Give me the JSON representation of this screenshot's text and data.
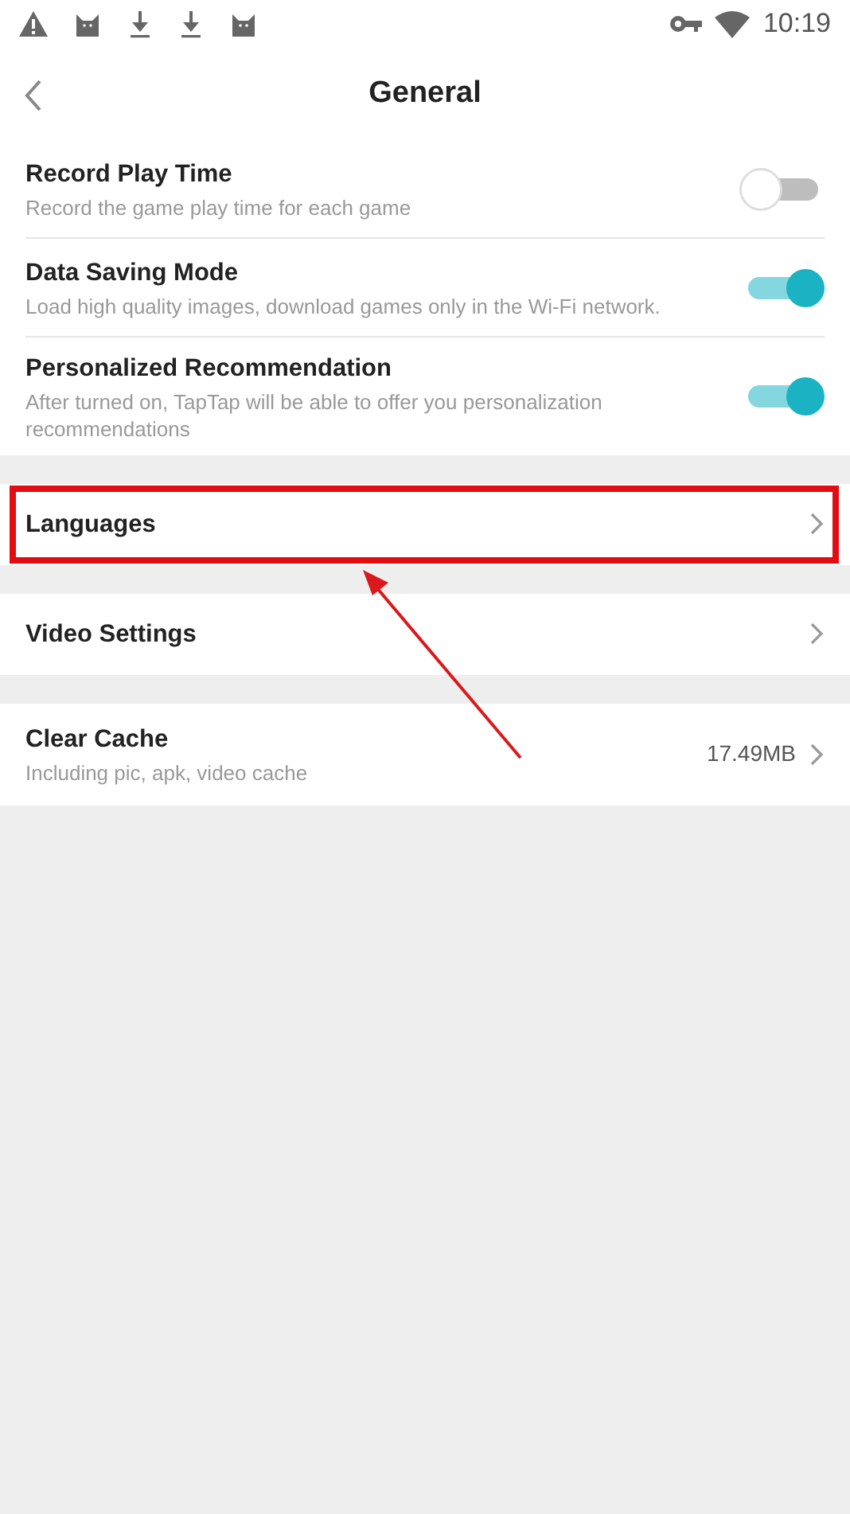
{
  "status_bar": {
    "time": "10:19"
  },
  "header": {
    "title": "General"
  },
  "groups": [
    {
      "items": [
        {
          "kind": "toggle",
          "title": "Record Play Time",
          "subtitle": "Record the game play time for each game",
          "on": false
        },
        {
          "kind": "toggle",
          "title": "Data Saving Mode",
          "subtitle": "Load high quality images, download games only in the Wi-Fi network.",
          "on": true
        },
        {
          "kind": "toggle",
          "title": "Personalized Recommendation",
          "subtitle": "After turned on, TapTap will be able to offer you personalization recommendations",
          "on": true
        }
      ]
    },
    {
      "items": [
        {
          "kind": "link",
          "title": "Languages",
          "highlighted": true
        }
      ]
    },
    {
      "items": [
        {
          "kind": "link",
          "title": "Video Settings",
          "highlighted": false
        }
      ]
    },
    {
      "items": [
        {
          "kind": "link",
          "title": "Clear Cache",
          "subtitle": "Including pic, apk, video cache",
          "value": "17.49MB",
          "highlighted": false
        }
      ]
    }
  ]
}
